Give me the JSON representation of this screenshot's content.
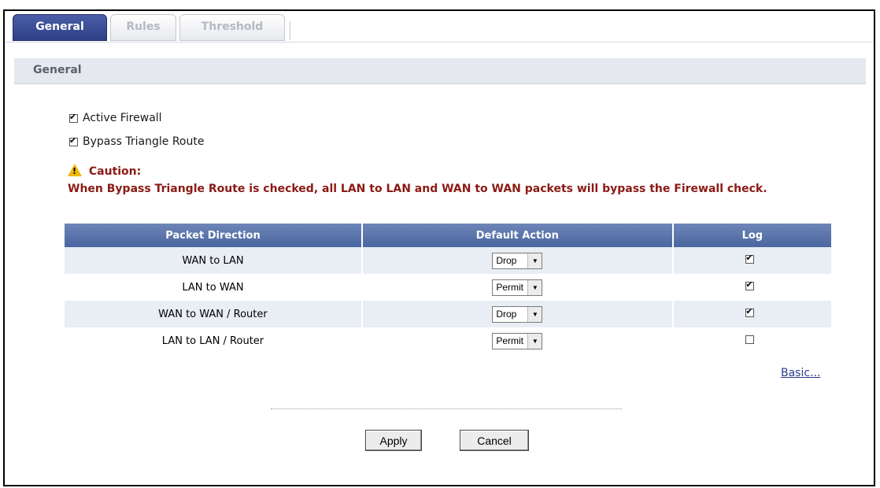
{
  "tabs": [
    {
      "label": "General"
    },
    {
      "label": "Rules"
    },
    {
      "label": "Threshold"
    }
  ],
  "section": {
    "title": "General"
  },
  "options": {
    "active_firewall": {
      "label": "Active Firewall",
      "checked": true
    },
    "bypass_triangle": {
      "label": "Bypass Triangle Route",
      "checked": true
    }
  },
  "caution": {
    "title": "Caution:",
    "message": "When Bypass Triangle Route is checked, all LAN to LAN and WAN to WAN packets will bypass the Firewall check."
  },
  "table": {
    "headers": [
      "Packet Direction",
      "Default Action",
      "Log"
    ],
    "rows": [
      {
        "direction": "WAN to LAN",
        "action": "Drop",
        "log": true
      },
      {
        "direction": "LAN to WAN",
        "action": "Permit",
        "log": true
      },
      {
        "direction": "WAN to WAN / Router",
        "action": "Drop",
        "log": true
      },
      {
        "direction": "LAN to LAN / Router",
        "action": "Permit",
        "log": false
      }
    ]
  },
  "links": {
    "basic": "Basic..."
  },
  "buttons": {
    "apply": "Apply",
    "cancel": "Cancel"
  },
  "colors": {
    "active_tab": "#3a4d95",
    "caution_text": "#8b1a14",
    "header_bg": "#5a74aa"
  }
}
